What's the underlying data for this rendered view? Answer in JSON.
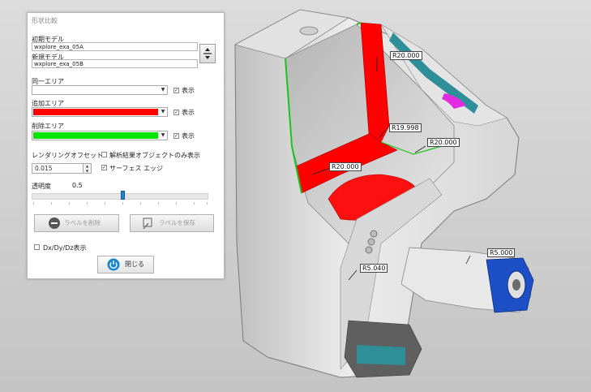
{
  "panel": {
    "title": "形状比較",
    "initial_model_label": "初期モデル",
    "initial_model_value": "wxplore_exa_05A",
    "new_model_label": "新規モデル",
    "new_model_value": "wxplore_exa_05B",
    "same_area_label": "同一エリア",
    "added_area_label": "追加エリア",
    "deleted_area_label": "削除エリア",
    "show_label": "表示",
    "rendering_offset_label": "レンダリングオフセット",
    "rendering_offset_value": "0.015",
    "analysis_only_label": "解析結果オブジェクトのみ表示",
    "surface_edge_label": "サーフェス エッジ",
    "transparency_label": "透明度",
    "transparency_value": "0.5",
    "delete_label_button": "ラベルを削除",
    "save_label_button": "ラベルを保存",
    "dxdydz_label": "Dx/Dy/Dz表示",
    "close_button": "閉じる"
  },
  "colors": {
    "added": "#ff0000",
    "deleted": "#00e600",
    "accent": "#1a86d0"
  },
  "checkboxes": {
    "same_area_show": true,
    "added_area_show": true,
    "deleted_area_show": true,
    "analysis_only": false,
    "surface_edge": true,
    "dxdydz": false
  },
  "slider": {
    "transparency_fraction": 0.5
  },
  "labels3d": {
    "r1": "R20.000",
    "r2": "R19.998",
    "r3": "R20.000",
    "r4": "R20.000",
    "r5": "R5.000",
    "r6": "R5.040"
  }
}
